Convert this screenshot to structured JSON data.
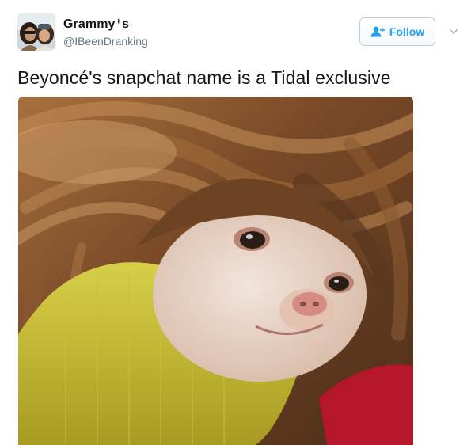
{
  "tweet": {
    "display_name": "Grammy⁺s",
    "handle": "@IBeenDranking",
    "text": "Beyoncé's snapchat name is a Tidal exclusive",
    "follow_label": "Follow",
    "avatar_icon": "user-avatar",
    "follow_icon": "add-user-icon",
    "caret_icon": "chevron-down-icon",
    "media_icon": "photo-chihuahua-in-wig"
  },
  "colors": {
    "accent": "#1da1f2",
    "text_primary": "#14171a",
    "text_secondary": "#657786",
    "border": "#c4ced6"
  }
}
